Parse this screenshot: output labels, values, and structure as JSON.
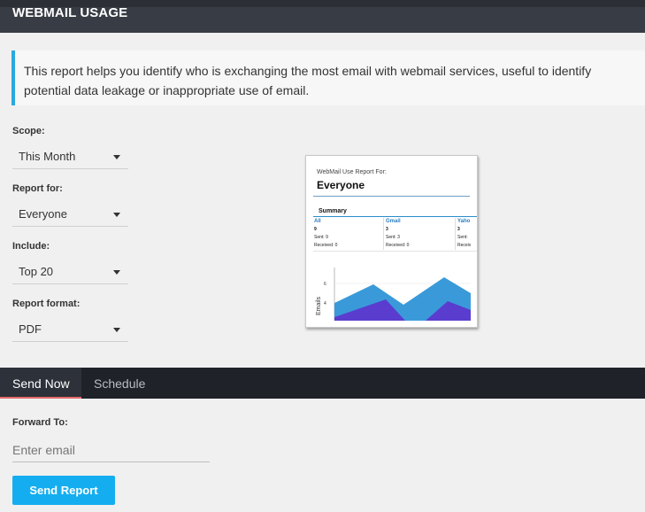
{
  "header": {
    "title": "WEBMAIL USAGE"
  },
  "info": {
    "text": "This report helps you identify who is exchanging the most email with webmail services, useful to identify potential data leakage or inappropriate use of email."
  },
  "form": {
    "scope": {
      "label": "Scope:",
      "value": "This Month"
    },
    "report_for": {
      "label": "Report for:",
      "value": "Everyone"
    },
    "include": {
      "label": "Include:",
      "value": "Top 20"
    },
    "report_format": {
      "label": "Report format:",
      "value": "PDF"
    }
  },
  "preview": {
    "report_for_label": "WebMail Use Report For:",
    "report_name": "Everyone",
    "summary_label": "Summary",
    "columns": [
      {
        "name": "All",
        "count": "9",
        "sent": "Sent: 9",
        "received": "Received: 0"
      },
      {
        "name": "Gmail",
        "count": "3",
        "sent": "Sent: 3",
        "received": "Received: 0"
      },
      {
        "name": "Yaho",
        "count": "3",
        "sent": "Sent:",
        "received": "Receiv"
      }
    ],
    "chart": {
      "ylabel": "Emails",
      "ticks": [
        "6",
        "4"
      ],
      "colors": {
        "series1": "#3a9ad9",
        "series2": "#5a3ccf"
      }
    }
  },
  "tabs": {
    "send_now": "Send Now",
    "schedule": "Schedule"
  },
  "forward": {
    "label": "Forward To:",
    "placeholder": "Enter email"
  },
  "send_button": "Send Report",
  "colors": {
    "accent": "#14aef0",
    "header_bg": "#383c44",
    "tab_active_underline": "#e56a6a",
    "info_border": "#2aa8e0"
  }
}
